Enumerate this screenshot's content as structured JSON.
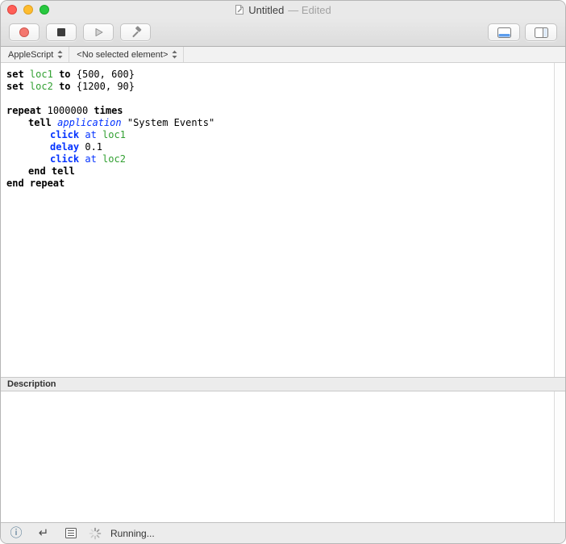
{
  "window": {
    "title": "Untitled",
    "edited": "— Edited"
  },
  "toolbar": {
    "icons": {
      "record": "record-circle",
      "stop": "stop-square",
      "run": "play-triangle",
      "compile": "hammer",
      "bottom_pane_toggle": "panel-bottom",
      "side_pane_toggle": "panel-right"
    },
    "accent_blue": "#5c9ded"
  },
  "navbar": {
    "language": "AppleScript",
    "element": "<No selected element>"
  },
  "code": {
    "colors": {
      "keyword": "#000000",
      "variable": "#31a031",
      "command": "#0433ff",
      "param": "#0433ff",
      "application": "#0433ff",
      "plain": "#000000"
    },
    "lines": [
      {
        "indent": 0,
        "tokens": [
          {
            "text": "set",
            "style": "kw"
          },
          {
            "text": "loc1",
            "style": "var"
          },
          {
            "text": "to",
            "style": "kw"
          },
          {
            "text": "{500, 600}",
            "style": "plain"
          }
        ]
      },
      {
        "indent": 0,
        "tokens": [
          {
            "text": "set",
            "style": "kw"
          },
          {
            "text": "loc2",
            "style": "var"
          },
          {
            "text": "to",
            "style": "kw"
          },
          {
            "text": "{1200, 90}",
            "style": "plain"
          }
        ]
      },
      {
        "indent": 0,
        "tokens": []
      },
      {
        "indent": 0,
        "tokens": [
          {
            "text": "repeat",
            "style": "kw"
          },
          {
            "text": "1000000",
            "style": "plain"
          },
          {
            "text": "times",
            "style": "kw"
          }
        ]
      },
      {
        "indent": 1,
        "tokens": [
          {
            "text": "tell",
            "style": "kw"
          },
          {
            "text": "application",
            "style": "app"
          },
          {
            "text": "\"System Events\"",
            "style": "plain"
          }
        ]
      },
      {
        "indent": 2,
        "tokens": [
          {
            "text": "click",
            "style": "cmd"
          },
          {
            "text": "at",
            "style": "param"
          },
          {
            "text": "loc1",
            "style": "var"
          }
        ]
      },
      {
        "indent": 2,
        "tokens": [
          {
            "text": "delay",
            "style": "cmd"
          },
          {
            "text": "0.1",
            "style": "plain"
          }
        ]
      },
      {
        "indent": 2,
        "tokens": [
          {
            "text": "click",
            "style": "cmd"
          },
          {
            "text": "at",
            "style": "param"
          },
          {
            "text": "loc2",
            "style": "var"
          }
        ]
      },
      {
        "indent": 1,
        "tokens": [
          {
            "text": "end tell",
            "style": "kw"
          }
        ]
      },
      {
        "indent": 0,
        "tokens": [
          {
            "text": "end repeat",
            "style": "kw"
          }
        ]
      }
    ]
  },
  "description": {
    "header": "Description"
  },
  "statusbar": {
    "status": "Running...",
    "icons": {
      "info": "info-circle",
      "event_log": "return-arrow",
      "description_doc": "document-lines",
      "busy": "progress-spinner"
    }
  }
}
